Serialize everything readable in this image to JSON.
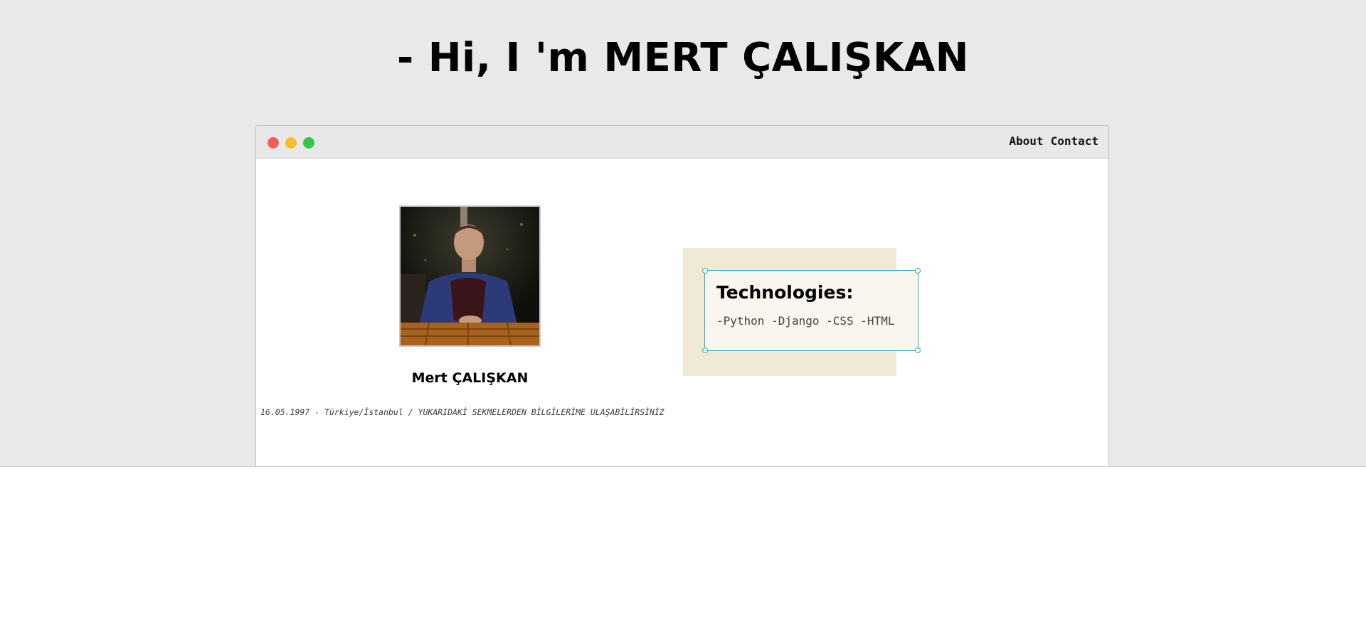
{
  "hero": {
    "title": "- Hi, I 'm MERT ÇALIŞKAN"
  },
  "window": {
    "controls": {
      "close_color": "#f25f58",
      "minimize_color": "#fbbd2e",
      "maximize_color": "#33c748"
    },
    "nav": {
      "about_label": "About",
      "contact_label": "Contact"
    }
  },
  "profile": {
    "name": "Mert ÇALIŞKAN",
    "bio": "16.05.1997 - Türkiye/İstanbul / YUKARIDAKİ SEKMELERDEN BİLGİLERİME ULAŞABİLİRSİNİZ"
  },
  "technologies": {
    "title": "Technologies:",
    "list": "-Python -Django -CSS -HTML"
  },
  "colors": {
    "page_background": "#e9e9e9",
    "accent_border": "#2aa9b8",
    "card_background": "#f0e9d6"
  }
}
